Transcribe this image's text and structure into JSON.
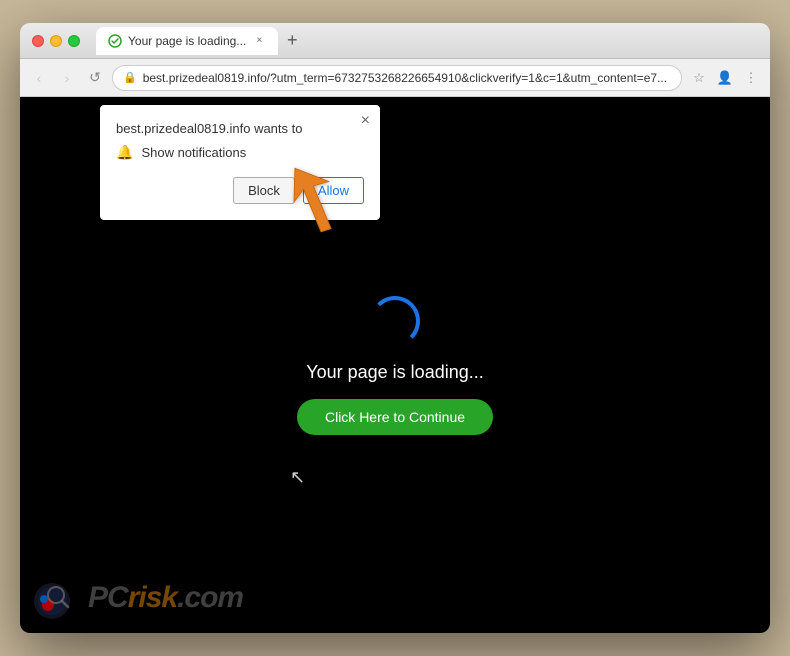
{
  "window": {
    "title": "Your page is loading...",
    "tab_title": "Your page is loading...",
    "url": "best.prizedeal0819.info/?utm_term=6732753268226654910&clickverify=1&c=1&utm_content=e7..."
  },
  "nav": {
    "back_label": "‹",
    "forward_label": "›",
    "reload_label": "↺",
    "new_tab_label": "+",
    "bookmark_label": "☆",
    "account_label": "👤",
    "menu_label": "⋮"
  },
  "popup": {
    "domain": "best.prizedeal0819.info",
    "wants_to": "wants to",
    "notification_label": "Show notifications",
    "block_label": "Block",
    "allow_label": "Allow",
    "close_label": "×"
  },
  "page": {
    "loading_text": "Your page is loading...",
    "continue_label": "Click Here to Continue"
  },
  "watermark": {
    "text_pc": "PC",
    "text_risk": "risk",
    "text_domain": ".com"
  },
  "colors": {
    "allow_button": "#1a73e8",
    "continue_button": "#28a428",
    "spinner": "#1a73e8",
    "arrow": "#e67e22"
  }
}
